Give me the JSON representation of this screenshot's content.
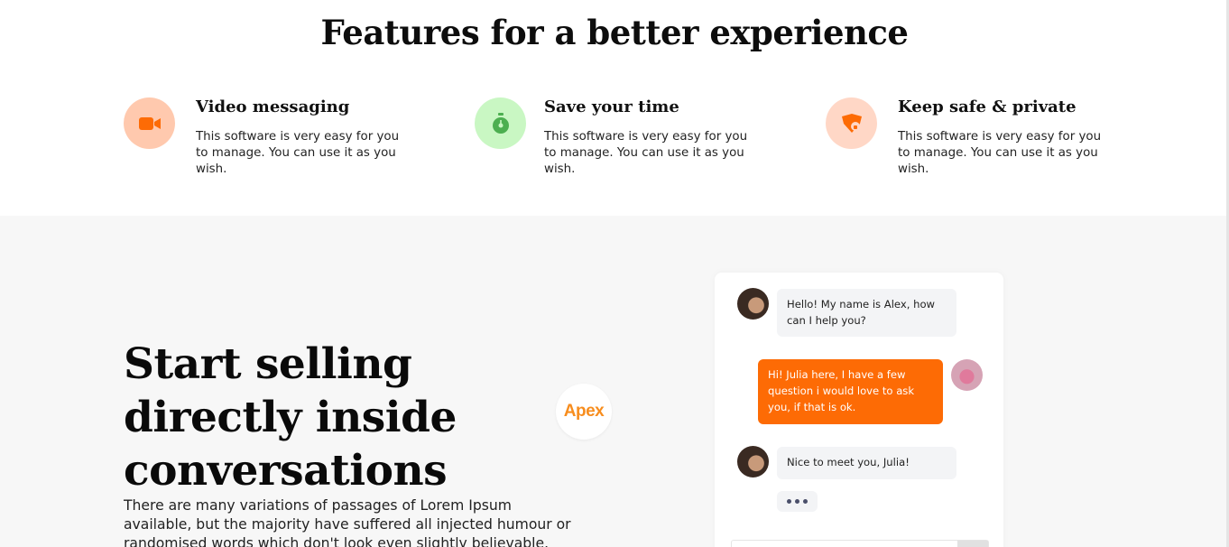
{
  "features_section": {
    "title": "Features for a better experience",
    "items": [
      {
        "icon": "video-camera-icon",
        "title": "Video messaging",
        "description": "This software is very easy for you to manage. You can use it as you wish.",
        "accent": "#fd6b05"
      },
      {
        "icon": "stopwatch-icon",
        "title": "Save your time",
        "description": "This software is very easy for you to manage. You can use it as you wish.",
        "accent": "#4caf50"
      },
      {
        "icon": "shield-icon",
        "title": "Keep safe & private",
        "description": "This software is very easy for you to manage. You can use it as you wish.",
        "accent": "#fd6b05"
      }
    ]
  },
  "selling_section": {
    "heading_lines": [
      "Start selling",
      "directly inside",
      "conversations"
    ],
    "description": "There are many variations of passages of Lorem Ipsum available, but the majority have suffered all injected humour or randomised words which don't look even slightly believable.",
    "badge_label": "Apex",
    "chat": {
      "messages": [
        {
          "sender": "Alex",
          "text": "Hello! My name is Alex, how can I help you?"
        },
        {
          "sender": "Julia",
          "text": "Hi! Julia here, I have a few question i would love to ask you, if that is ok."
        },
        {
          "sender": "Alex",
          "text": "Nice to meet you, Julia!"
        }
      ]
    }
  },
  "colors": {
    "brand_orange": "#fd6b05",
    "badge_orange": "#f78d1e",
    "section_gray": "#f7f7f7"
  }
}
